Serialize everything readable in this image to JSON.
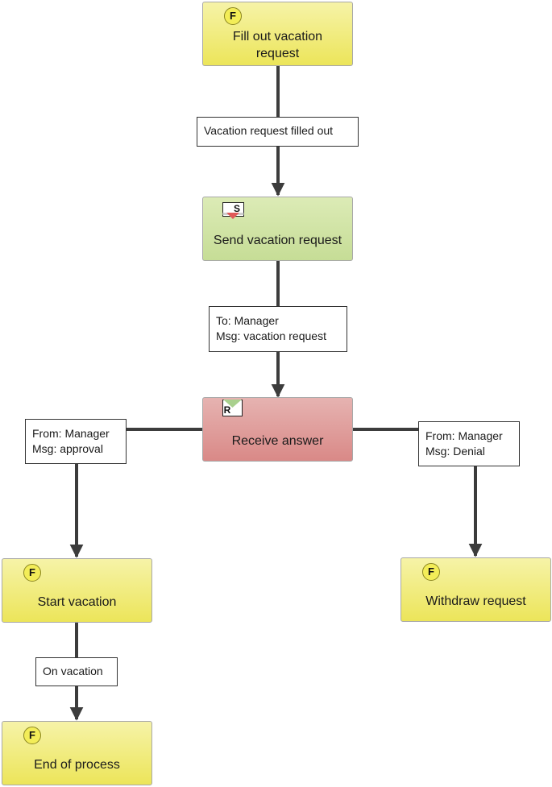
{
  "diagram": {
    "colors": {
      "function_fill": "#ece55a",
      "send_fill": "#c6dd96",
      "receive_fill": "#d98987",
      "edge": "#3c3c3c",
      "send_marker": "#e05858",
      "receive_marker": "#a9d08e"
    },
    "nodes": [
      {
        "id": "fill-out",
        "type": "function",
        "badge": "F",
        "label": "Fill out vacation request"
      },
      {
        "id": "send",
        "type": "send",
        "badge": "S",
        "label": "Send vacation request"
      },
      {
        "id": "receive",
        "type": "receive",
        "badge": "R",
        "label": "Receive answer"
      },
      {
        "id": "start-vacation",
        "type": "function",
        "badge": "F",
        "label": "Start vacation"
      },
      {
        "id": "withdraw",
        "type": "function",
        "badge": "F",
        "label": "Withdraw request"
      },
      {
        "id": "end",
        "type": "function",
        "badge": "F",
        "label": "End of process"
      }
    ],
    "edges": [
      {
        "from": "fill-out",
        "to": "send",
        "lines": [
          "Vacation request filled out"
        ]
      },
      {
        "from": "send",
        "to": "receive",
        "lines": [
          "To: Manager",
          "Msg: vacation request"
        ]
      },
      {
        "from": "receive",
        "to": "start-vacation",
        "lines": [
          "From: Manager",
          "Msg: approval"
        ]
      },
      {
        "from": "receive",
        "to": "withdraw",
        "lines": [
          "From: Manager",
          "Msg: Denial"
        ]
      },
      {
        "from": "start-vacation",
        "to": "end",
        "lines": [
          "On vacation"
        ]
      }
    ]
  }
}
